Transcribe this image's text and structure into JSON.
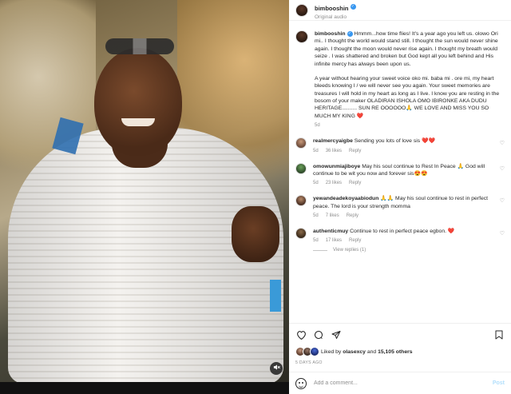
{
  "header": {
    "username": "bimbooshin",
    "subtitle": "Original audio",
    "more_icon": "more-horizontal-icon"
  },
  "caption": {
    "username": "bimbooshin",
    "text_p1": "Hmmm...how time flies! It's a year ago you left us. olowo Ori mi.. I thought the world would stand still. I thought the sun would never shine again. I thought the moon would never rise again. I thought my breath would seize . I was shattered and broken but God kept all you left behind and His infinite mercy has always been upon us.",
    "text_p2": "A year without hearing your sweet voice oko mi. baba mi . ore mi, my heart bleeds knowing I / we will never see you again. Your sweet memories are treasures I will hold in my heart as long as I live. I know you are resting in the bosom of your maker OLADIRAN ISHOLA OMO IBIRONKE AKA DUDU HERITAGE.......... SUN RE OOOOOO🙏 WE LOVE AND MISS YOU SO MUCH MY KING ❤️",
    "time": "5d"
  },
  "comments": [
    {
      "username": "realmercyaigbe",
      "text": "Sending you lots of love sis ❤️❤️",
      "time": "5d",
      "likes": "36 likes",
      "reply": "Reply"
    },
    {
      "username": "omowunmiajiboye",
      "text": "May his soul continue to Rest In Peace 🙏 God will continue to be wit you now and forever sis😍😍",
      "time": "5d",
      "likes": "23 likes",
      "reply": "Reply"
    },
    {
      "username": "yewandeadekoyaabiodun",
      "text": "🙏🙏 May his soul continue to rest in perfect peace. The lord is your strength momma",
      "time": "5d",
      "likes": "7 likes",
      "reply": "Reply"
    },
    {
      "username": "authenticmuy",
      "text": "Continue to rest in perfect peace egbon. ❤️",
      "time": "5d",
      "likes": "17 likes",
      "reply": "Reply"
    }
  ],
  "view_replies": "View replies (1)",
  "actions": {
    "liked_by_prefix": "Liked by ",
    "liked_by_user": "olasexcy",
    "liked_by_and": " and ",
    "liked_by_count": "15,105 others",
    "date": "5 DAYS AGO"
  },
  "add_comment": {
    "placeholder": "Add a comment...",
    "post_label": "Post"
  },
  "colors": {
    "accent": "#3897f0",
    "post_disabled": "#b2dffc",
    "heart_red": "#ed4956"
  }
}
